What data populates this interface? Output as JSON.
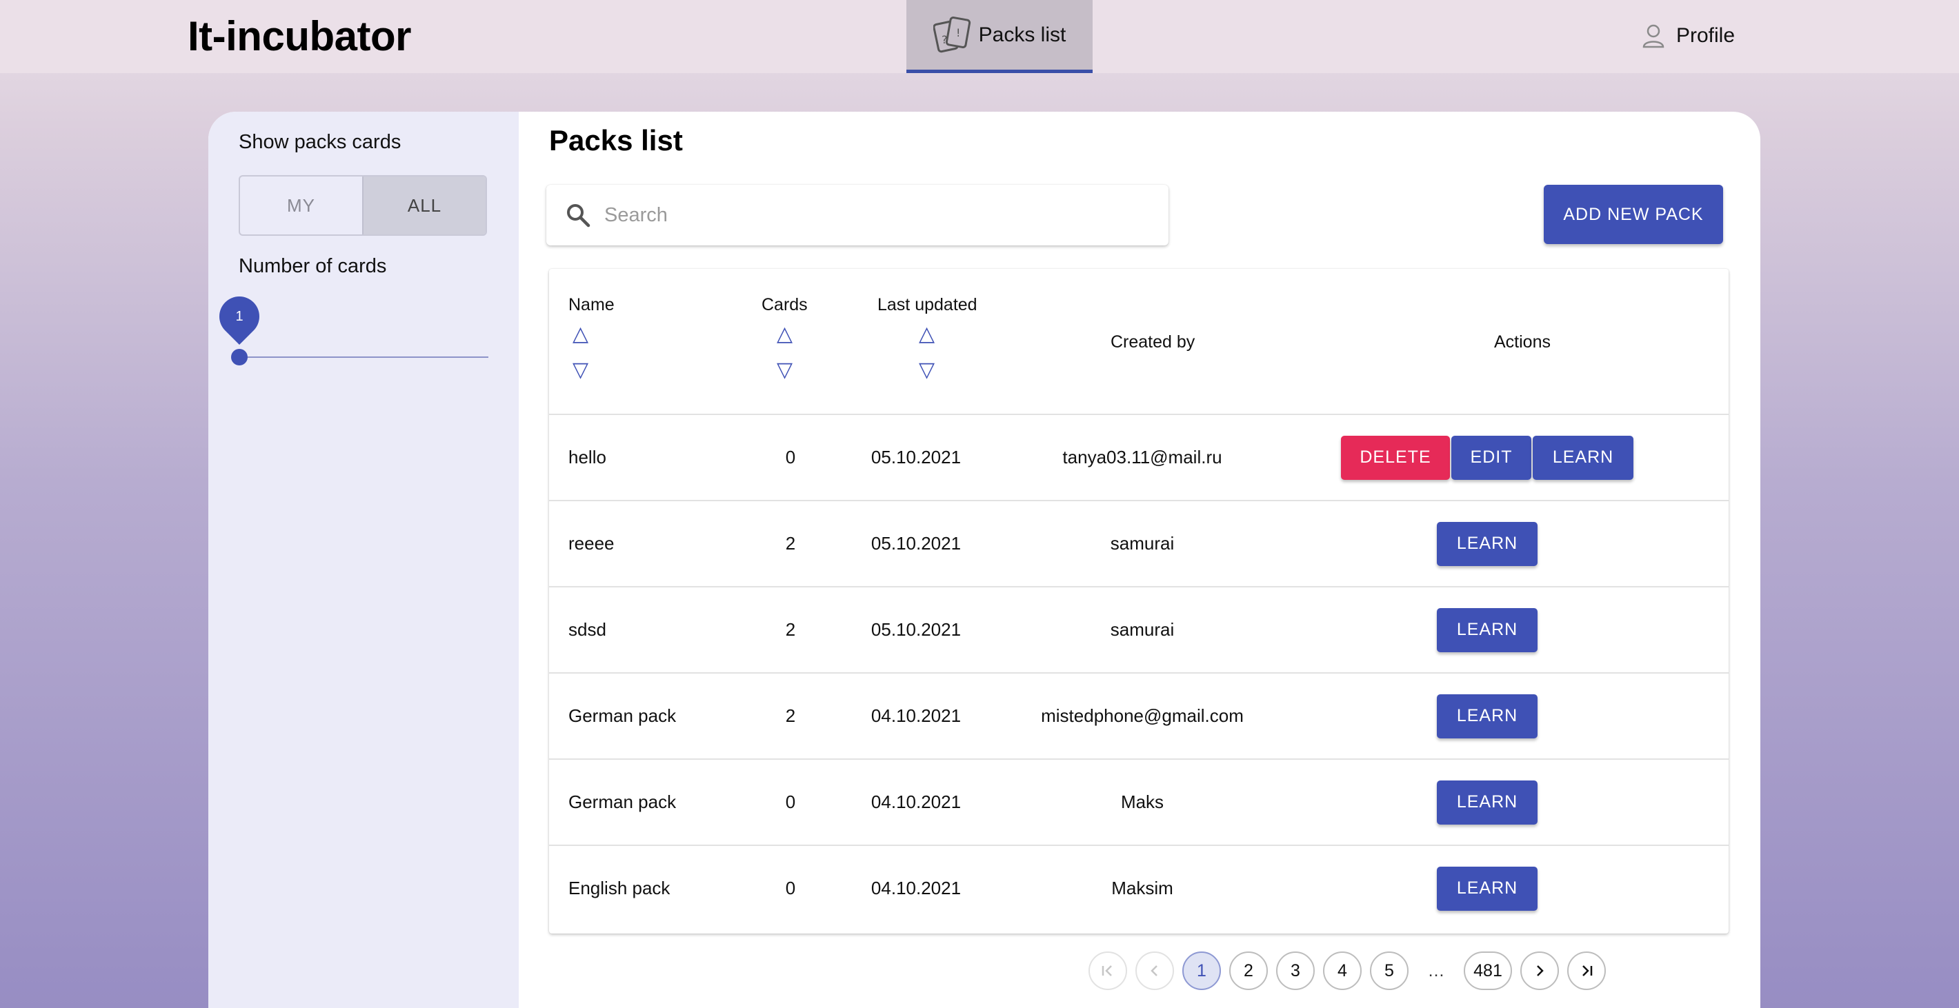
{
  "header": {
    "logo": "It-incubator",
    "nav_tab": "Packs list",
    "profile": "Profile"
  },
  "sidebar": {
    "title": "Show packs cards",
    "toggle": {
      "my": "MY",
      "all": "ALL",
      "selected": "ALL"
    },
    "cards_title": "Number of cards",
    "slider_value": "1"
  },
  "main": {
    "title": "Packs list",
    "search": {
      "placeholder": "Search",
      "value": ""
    },
    "add_button": "ADD NEW PACK",
    "table": {
      "columns": {
        "name": "Name",
        "cards": "Cards",
        "updated": "Last updated",
        "created_by": "Created by",
        "actions": "Actions"
      },
      "sort_up": "△",
      "sort_down": "▽",
      "rows": [
        {
          "name": "hello",
          "cards": "0",
          "updated": "05.10.2021",
          "created_by": "tanya03.11@mail.ru",
          "actions": [
            "DELETE",
            "EDIT",
            "LEARN"
          ]
        },
        {
          "name": "reeee",
          "cards": "2",
          "updated": "05.10.2021",
          "created_by": "samurai",
          "actions": [
            "LEARN"
          ]
        },
        {
          "name": "sdsd",
          "cards": "2",
          "updated": "05.10.2021",
          "created_by": "samurai",
          "actions": [
            "LEARN"
          ]
        },
        {
          "name": "German pack",
          "cards": "2",
          "updated": "04.10.2021",
          "created_by": "mistedphone@gmail.com",
          "actions": [
            "LEARN"
          ]
        },
        {
          "name": "German pack",
          "cards": "0",
          "updated": "04.10.2021",
          "created_by": "Maks",
          "actions": [
            "LEARN"
          ]
        },
        {
          "name": "English pack",
          "cards": "0",
          "updated": "04.10.2021",
          "created_by": "Maksim",
          "actions": [
            "LEARN"
          ]
        }
      ]
    },
    "pagination": {
      "pages": [
        "1",
        "2",
        "3",
        "4",
        "5"
      ],
      "ellipsis": "…",
      "last_page": "481",
      "current": "1"
    }
  },
  "colors": {
    "primary": "#3f51b5",
    "danger": "#e62a58",
    "sidebar_bg": "#ebebf8",
    "header_bg": "#ebe0e8"
  },
  "icons": {
    "nav_tab": "cards-icon",
    "profile": "user-icon",
    "search": "search-icon",
    "pagination": [
      "first-page-icon",
      "chevron-left-icon",
      "chevron-right-icon",
      "last-page-icon"
    ]
  }
}
